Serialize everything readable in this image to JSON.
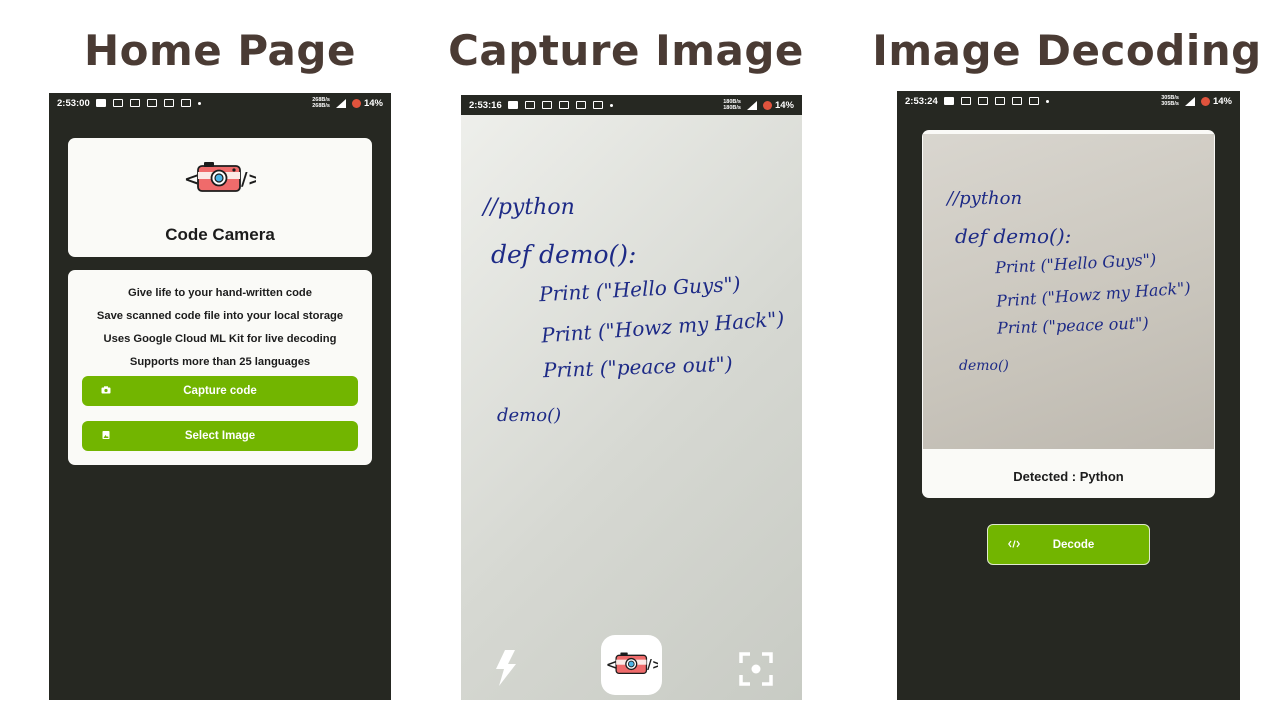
{
  "headings": {
    "home": "Home Page",
    "capture": "Capture Image",
    "decoding": "Image Decoding"
  },
  "status_bar": {
    "home": {
      "time": "2:53:00",
      "speed_up": "268B/s",
      "speed_down": "268B/s",
      "battery": "14%"
    },
    "capture": {
      "time": "2:53:16",
      "speed_up": "180B/s",
      "speed_down": "180B/s",
      "battery": "14%"
    },
    "decoding": {
      "time": "2:53:24",
      "speed_up": "305B/s",
      "speed_down": "305B/s",
      "battery": "14%"
    }
  },
  "home": {
    "app_name": "Code Camera",
    "features": [
      "Give life to your hand-written code",
      "Save scanned code file into your local storage",
      "Uses Google Cloud ML Kit for live decoding",
      "Supports more than 25 languages"
    ],
    "capture_button": "Capture code",
    "select_button": "Select Image",
    "logo_icon": "code-camera-logo-icon",
    "accent_color": "#72b500"
  },
  "handwriting": {
    "line1": "//python",
    "line2": "def demo():",
    "line3": "Print (\"Hello Guys\")",
    "line4": "Print (\"Howz my Hack\")",
    "line5": "Print (\"peace out\")",
    "line6": "demo()"
  },
  "capture": {
    "flash_icon": "flash-icon",
    "shutter_icon": "code-camera-logo-icon",
    "focus_icon": "focus-frame-icon"
  },
  "decoding": {
    "detected_text": "Detected : Python",
    "decode_button": "Decode",
    "decode_icon": "code-brackets-icon"
  },
  "colors": {
    "phone_background": "#262822",
    "heading_text": "#4a3b34",
    "ink": "#1d2a86",
    "button_green": "#72b500"
  }
}
